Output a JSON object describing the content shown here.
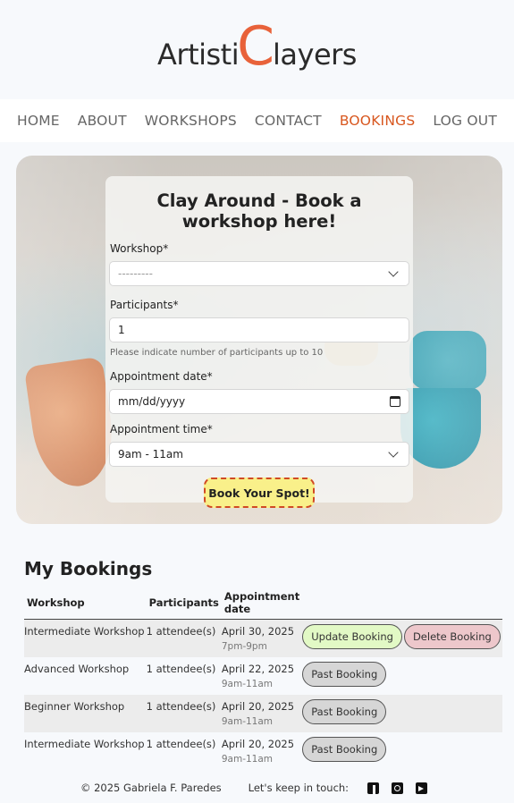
{
  "brand": {
    "part1": "Artisti",
    "big_letter": "C",
    "part2": "layers"
  },
  "nav": {
    "items": [
      {
        "label": "HOME"
      },
      {
        "label": "ABOUT"
      },
      {
        "label": "WORKSHOPS"
      },
      {
        "label": "CONTACT"
      },
      {
        "label": "BOOKINGS",
        "active": true
      },
      {
        "label": "LOG OUT"
      }
    ]
  },
  "form": {
    "title": "Clay Around - Book a workshop here!",
    "workshop_label": "Workshop*",
    "workshop_value": "---------",
    "participants_label": "Participants*",
    "participants_value": "1",
    "participants_help": "Please indicate number of participants up to 10",
    "date_label": "Appointment date*",
    "date_value": "mm/dd/yyyy",
    "time_label": "Appointment time*",
    "time_value": "9am - 11am",
    "submit_label": "Book Your Spot!"
  },
  "bookings": {
    "title": "My Bookings",
    "headers": [
      "Workshop",
      "Participants",
      "Appointment date"
    ],
    "rows": [
      {
        "workshop": "Intermediate Workshop",
        "participants": "1 attendee(s)",
        "date": "April 30, 2025",
        "time": "7pm-9pm",
        "actions": [
          "Update Booking",
          "Delete Booking"
        ]
      },
      {
        "workshop": "Advanced Workshop",
        "participants": "1 attendee(s)",
        "date": "April 22, 2025",
        "time": "9am-11am",
        "actions": [
          "Past Booking"
        ]
      },
      {
        "workshop": "Beginner Workshop",
        "participants": "1 attendee(s)",
        "date": "April 20, 2025",
        "time": "9am-11am",
        "actions": [
          "Past Booking"
        ]
      },
      {
        "workshop": "Intermediate Workshop",
        "participants": "1 attendee(s)",
        "date": "April 20, 2025",
        "time": "9am-11am",
        "actions": [
          "Past Booking"
        ]
      }
    ]
  },
  "footer": {
    "copyright": "© 2025 Gabriela F. Paredes",
    "keep_in_touch": "Let's keep in touch:",
    "social_icons": [
      "facebook-icon",
      "instagram-icon",
      "youtube-icon"
    ]
  },
  "colors": {
    "accent": "#e8623a",
    "nav_active": "#d8571f",
    "button_yellow": "#f9f08a",
    "update_green": "#e2f9c5",
    "delete_pink": "#edc7cb"
  }
}
